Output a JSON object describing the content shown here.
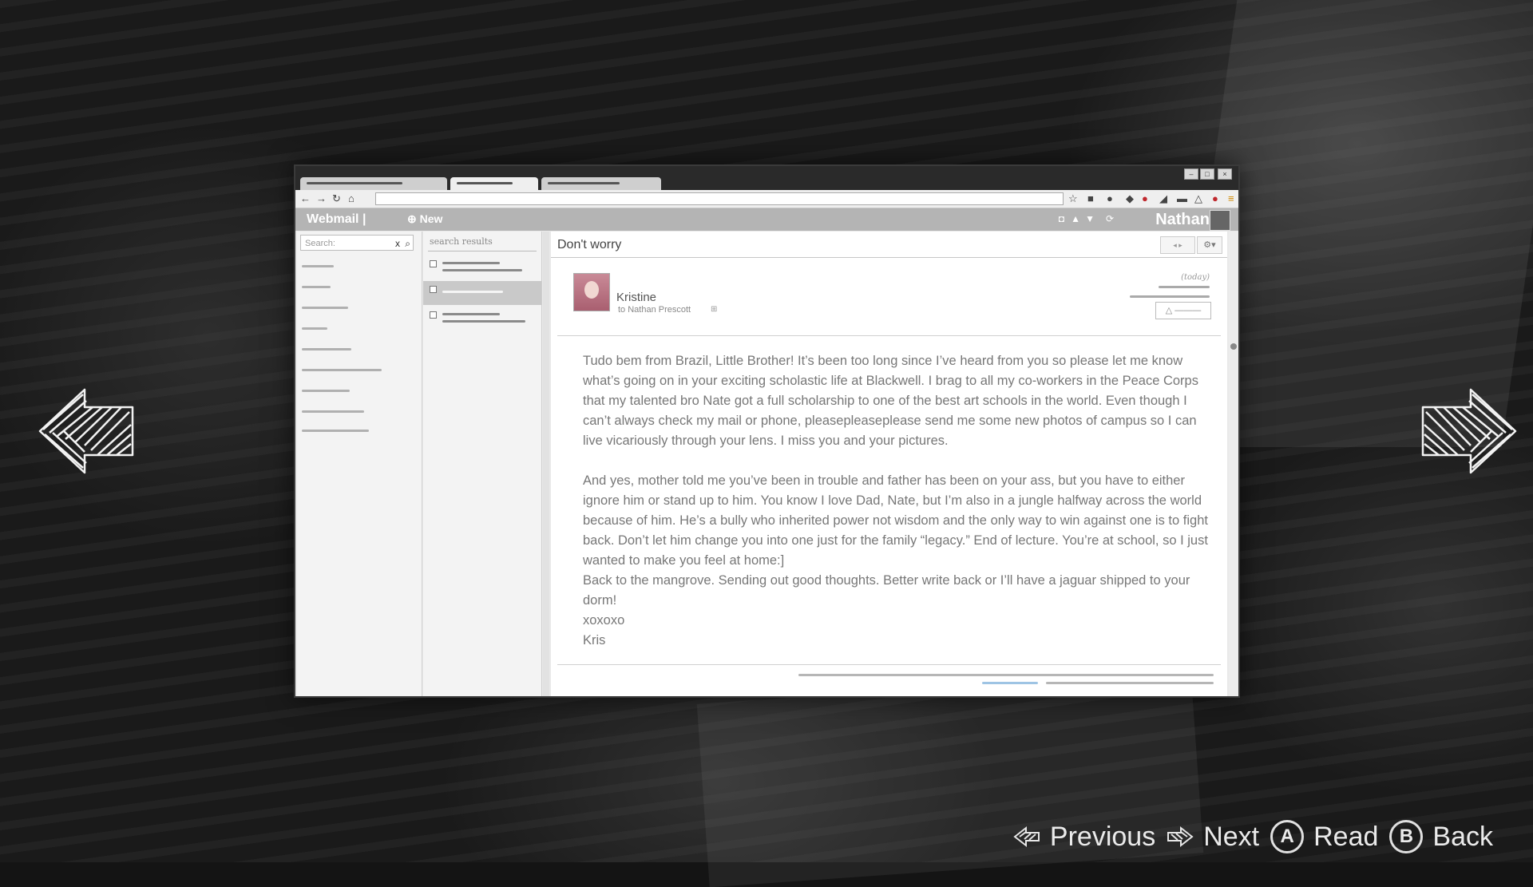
{
  "webmail": {
    "brand": "Webmail",
    "brand_divider": "|",
    "new_button": "New",
    "user_name": "Nathan",
    "search_placeholder": "Search:",
    "search_results_label": "search results"
  },
  "email": {
    "subject": "Don't worry",
    "sender_name": "Kristine",
    "recipient": "to Nathan Prescott",
    "date_label": "(today)",
    "paragraphs": [
      "Tudo bem from Brazil, Little Brother! It’s been too long since I’ve heard from you so please let me know what’s going on in your exciting scholastic life at Blackwell. I brag to all my co-workers in the Peace Corps that my talented bro Nate got a full scholarship to one of the best art schools in the world. Even though I can’t always check my mail or phone, pleasepleaseplease send me some new photos of campus so I can live vicariously through your lens. I miss you and your pictures.",
      "And yes, mother told me you’ve been in trouble and father has been on your ass, but you have to either ignore him or stand up to him. You know I love Dad, Nate, but I’m also in a jungle halfway across the world because of him. He’s a bully who inherited power not wisdom and the only way to win against one is to fight back. Don’t let him change you into one just for the family “legacy.” End of lecture. You’re at school, so I just wanted to make you feel at home:]",
      "Back to the mangrove. Sending out good thoughts. Better write back or I’ll have a jaguar shipped to your dorm!",
      "xoxoxo",
      "Kris"
    ]
  },
  "prompts": {
    "previous": "Previous",
    "next": "Next",
    "read": "Read",
    "read_button": "A",
    "back": "Back",
    "back_button": "B"
  },
  "icons": {
    "left_arrow": "sketch-arrow-left-icon",
    "right_arrow": "sketch-arrow-right-icon"
  }
}
